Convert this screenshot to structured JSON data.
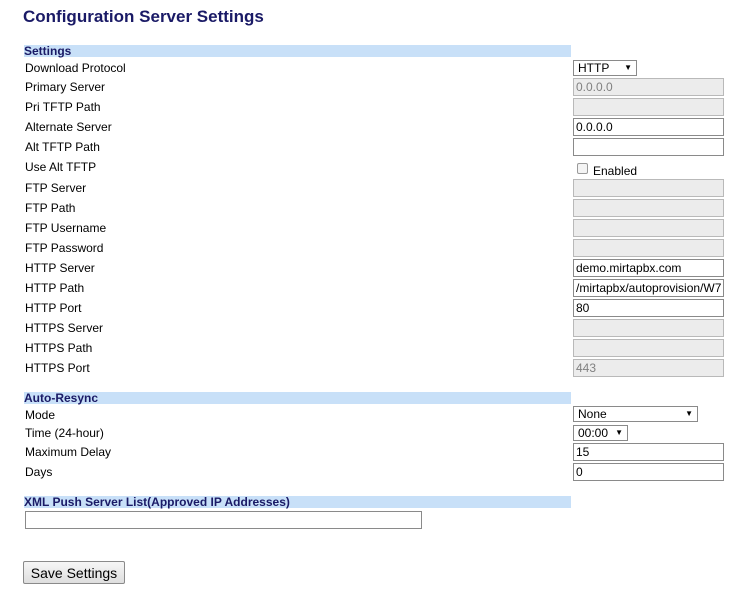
{
  "page": {
    "title": "Configuration Server Settings"
  },
  "settings": {
    "header": "Settings",
    "download_protocol": {
      "label": "Download Protocol",
      "value": "HTTP"
    },
    "primary_server": {
      "label": "Primary Server",
      "value": "0.0.0.0"
    },
    "pri_tftp_path": {
      "label": "Pri TFTP Path",
      "value": ""
    },
    "alternate_server": {
      "label": "Alternate Server",
      "value": "0.0.0.0"
    },
    "alt_tftp_path": {
      "label": "Alt TFTP Path",
      "value": ""
    },
    "use_alt_tftp": {
      "label": "Use Alt TFTP",
      "checkbox_label": "Enabled"
    },
    "ftp_server": {
      "label": "FTP Server",
      "value": ""
    },
    "ftp_path": {
      "label": "FTP Path",
      "value": ""
    },
    "ftp_username": {
      "label": "FTP Username",
      "value": ""
    },
    "ftp_password": {
      "label": "FTP Password",
      "value": ""
    },
    "http_server": {
      "label": "HTTP Server",
      "value": "demo.mirtapbx.com"
    },
    "http_path": {
      "label": "HTTP Path",
      "value": "/mirtapbx/autoprovision/W7I"
    },
    "http_port": {
      "label": "HTTP Port",
      "value": "80"
    },
    "https_server": {
      "label": "HTTPS Server",
      "value": ""
    },
    "https_path": {
      "label": "HTTPS Path",
      "value": ""
    },
    "https_port": {
      "label": "HTTPS Port",
      "value": "443"
    }
  },
  "auto_resync": {
    "header": "Auto-Resync",
    "mode": {
      "label": "Mode",
      "value": "None"
    },
    "time": {
      "label": "Time (24-hour)",
      "value": "00:00"
    },
    "max_delay": {
      "label": "Maximum Delay",
      "value": "15"
    },
    "days": {
      "label": "Days",
      "value": "0"
    }
  },
  "xml_push": {
    "header": "XML Push Server List(Approved IP Addresses)",
    "value": ""
  },
  "actions": {
    "save_label": "Save Settings"
  }
}
